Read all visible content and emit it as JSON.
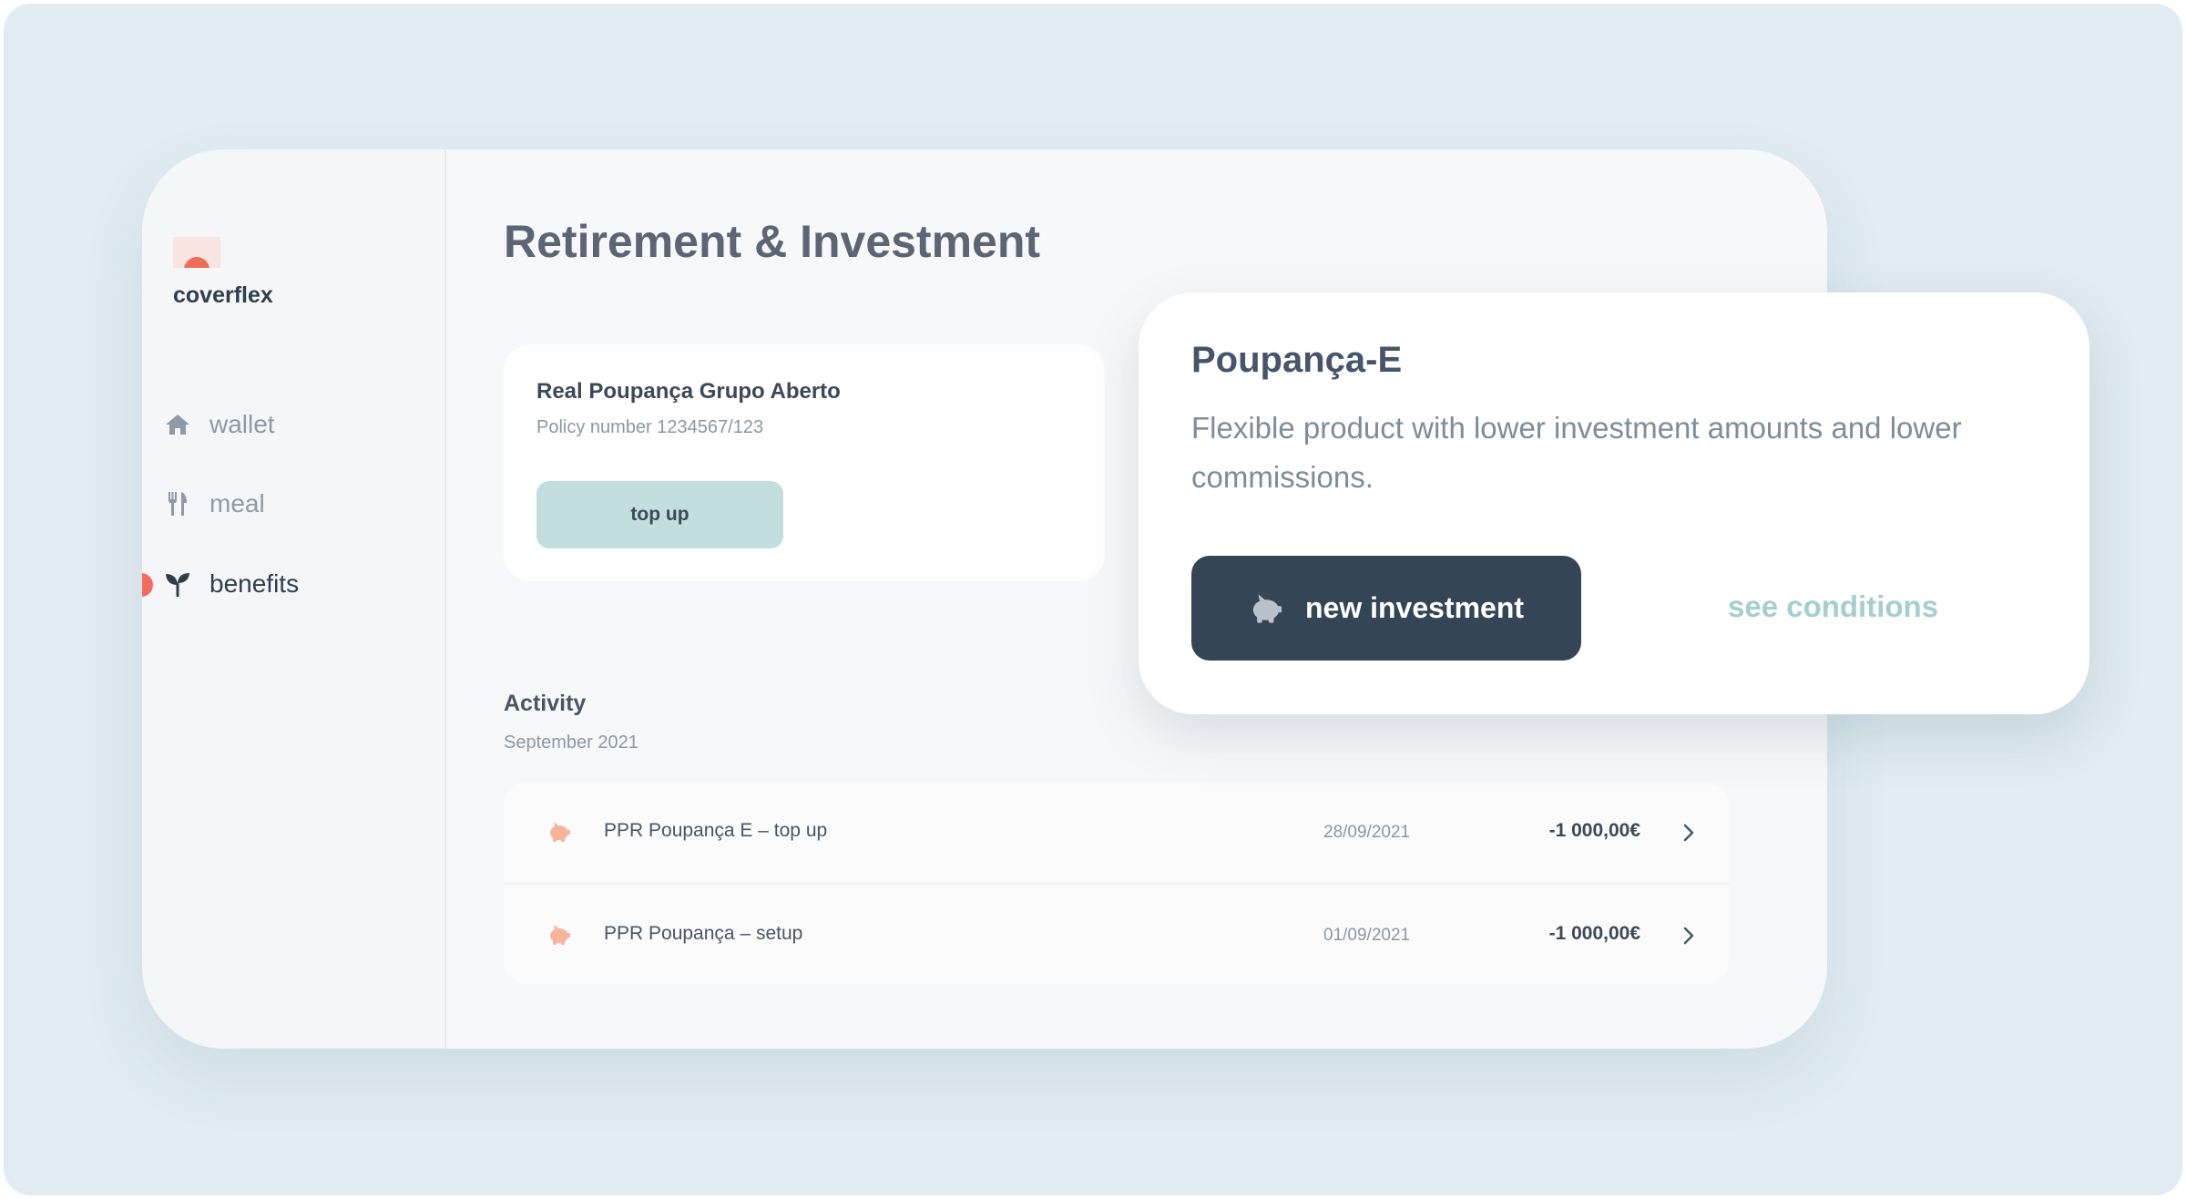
{
  "brand": {
    "name": "coverflex"
  },
  "sidebar": {
    "items": [
      {
        "label": "wallet",
        "icon": "home-icon",
        "active": false
      },
      {
        "label": "meal",
        "icon": "cutlery-icon",
        "active": false
      },
      {
        "label": "benefits",
        "icon": "sprout-icon",
        "active": true
      }
    ]
  },
  "page": {
    "title": "Retirement & Investment"
  },
  "policy": {
    "name": "Real Poupança Grupo Aberto",
    "number": "Policy number 1234567/123",
    "topup_label": "top up"
  },
  "activity": {
    "title": "Activity",
    "month": "September 2021",
    "rows": [
      {
        "icon": "piggy-bank-icon",
        "description": "PPR Poupança E – top up",
        "date": "28/09/2021",
        "amount": "-1 000,00€"
      },
      {
        "icon": "piggy-bank-icon",
        "description": "PPR Poupança – setup",
        "date": "01/09/2021",
        "amount": "-1 000,00€"
      }
    ]
  },
  "product": {
    "name": "Poupança-E",
    "description": "Flexible product with lower investment amounts and lower commissions.",
    "primary_label": "new investment",
    "primary_icon": "piggy-bank-icon",
    "link_label": "see conditions"
  },
  "colors": {
    "background": "#e0ecf1",
    "accent_dot": "#f36b5c",
    "primary_button": "#344656",
    "secondary_button": "#c3dedf",
    "link": "#a5cfcd",
    "activity_icon": "#f7b49a"
  }
}
